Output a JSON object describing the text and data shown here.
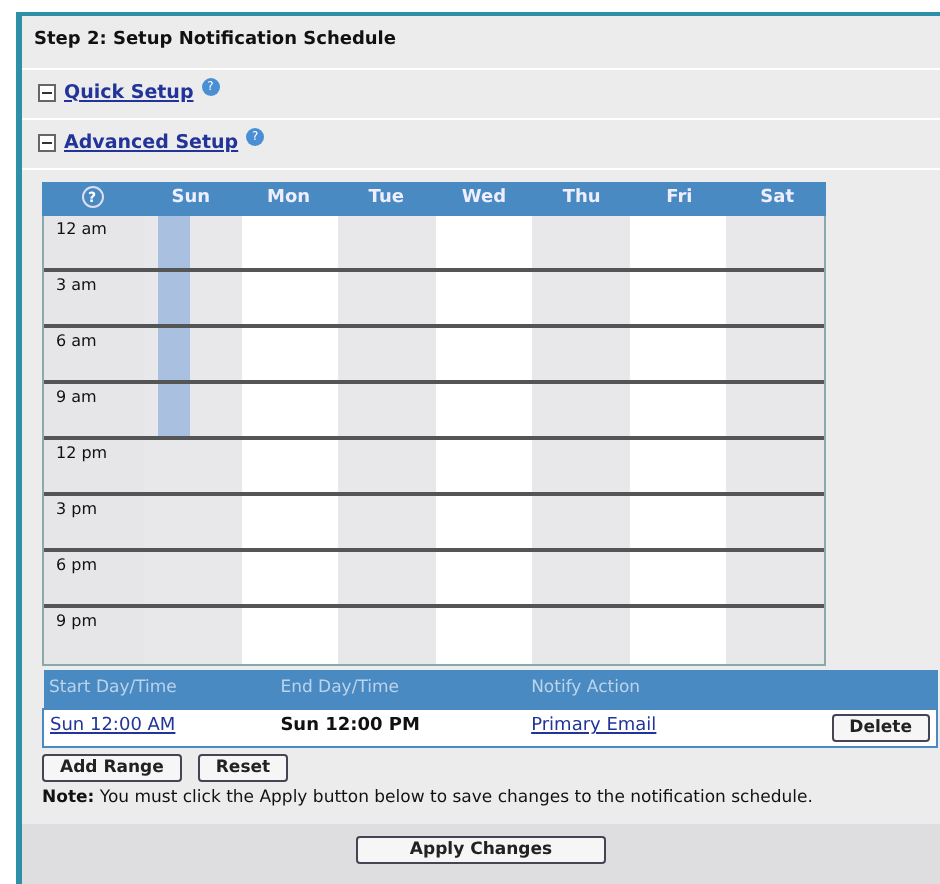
{
  "panel": {
    "title": "Step 2: Setup Notification Schedule"
  },
  "sections": [
    {
      "label": "Quick Setup",
      "expanded": true,
      "help": "?"
    },
    {
      "label": "Advanced Setup",
      "expanded": true,
      "help": "?"
    }
  ],
  "schedule": {
    "help": "?",
    "times": [
      "12 am",
      "3 am",
      "6 am",
      "9 am",
      "12 pm",
      "3 pm",
      "6 pm",
      "9 pm"
    ],
    "days": [
      {
        "label": "Sun",
        "filled": [
          true,
          true,
          true,
          true,
          false,
          false,
          false,
          false
        ]
      },
      {
        "label": "Mon",
        "filled": [
          false,
          false,
          false,
          false,
          false,
          false,
          false,
          false
        ]
      },
      {
        "label": "Tue",
        "filled": [
          false,
          false,
          false,
          false,
          false,
          false,
          false,
          false
        ]
      },
      {
        "label": "Wed",
        "filled": [
          false,
          false,
          false,
          false,
          false,
          false,
          false,
          false
        ]
      },
      {
        "label": "Thu",
        "filled": [
          false,
          false,
          false,
          false,
          false,
          false,
          false,
          false
        ]
      },
      {
        "label": "Fri",
        "filled": [
          false,
          false,
          false,
          false,
          false,
          false,
          false,
          false
        ]
      },
      {
        "label": "Sat",
        "filled": [
          false,
          false,
          false,
          false,
          false,
          false,
          false,
          false
        ]
      }
    ]
  },
  "ranges": {
    "columns": [
      "Start Day/Time",
      "End Day/Time",
      "Notify Action"
    ],
    "rows": [
      {
        "start": "Sun 12:00 AM",
        "end": "Sun 12:00 PM",
        "action": "Primary Email",
        "delete": "Delete"
      }
    ]
  },
  "buttons": [
    "Add Range",
    "Reset"
  ],
  "note": "**Note:** You must click the Apply button below to save changes to the notification schedule.",
  "apply": "Apply Changes"
}
